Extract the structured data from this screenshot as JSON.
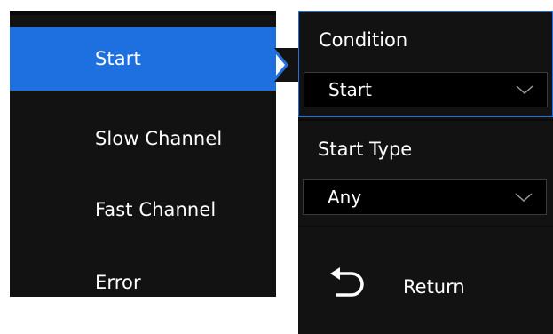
{
  "left_menu": {
    "items": [
      {
        "label": "Start",
        "active": true
      },
      {
        "label": "Slow Channel",
        "active": false
      },
      {
        "label": "Fast Channel",
        "active": false
      },
      {
        "label": "Error",
        "active": false
      }
    ]
  },
  "right_panel": {
    "condition": {
      "label": "Condition",
      "value": "Start"
    },
    "start_type": {
      "label": "Start Type",
      "value": "Any"
    },
    "return_label": "Return"
  },
  "colors": {
    "accent": "#1e6fe0",
    "panel_bg": "#121212",
    "select_bg": "#000000"
  },
  "icons": {
    "dropdown": "chevron-down-icon",
    "return": "return-arrow-icon",
    "pointer": "pointer-arrow-icon"
  }
}
